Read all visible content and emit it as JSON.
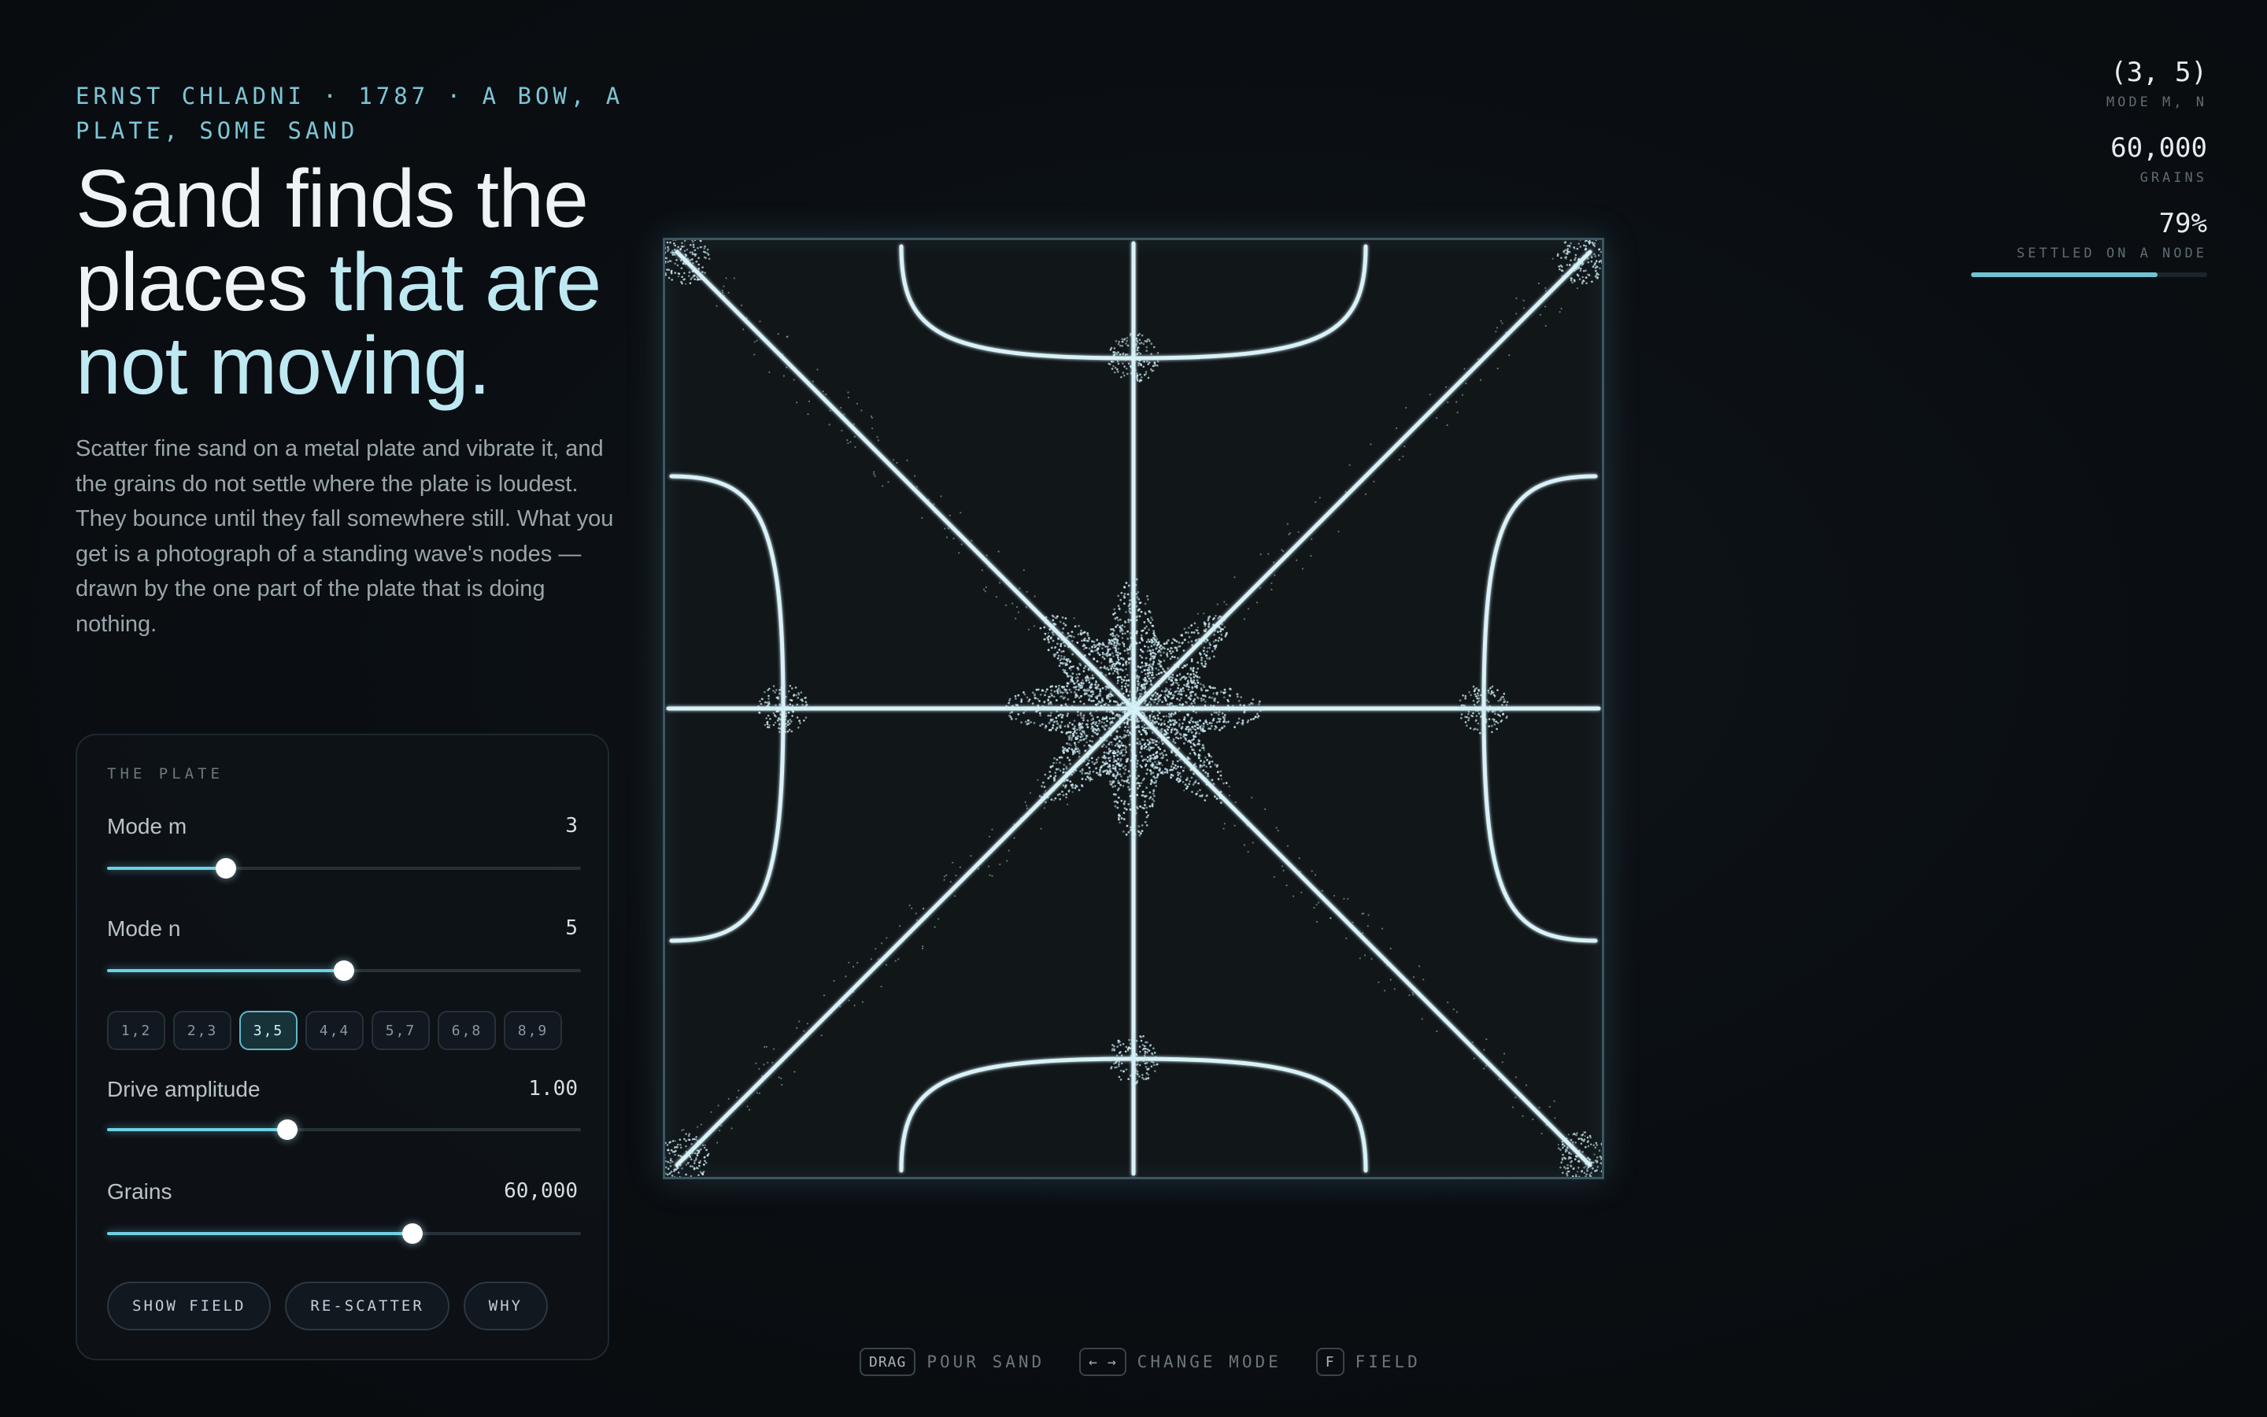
{
  "header": {
    "eyebrow": "ERNST CHLADNI · 1787 · A BOW, A PLATE, SOME SAND",
    "headline_lead": "Sand finds the places ",
    "headline_accent": "that are not moving.",
    "intro": "Scatter fine sand on a metal plate and vibrate it, and the grains do not settle where the plate is loudest. They bounce until they fall somewhere still. What you get is a photograph of a standing wave's nodes — drawn by the one part of the plate that is doing nothing."
  },
  "panel": {
    "title": "THE PLATE",
    "controls": [
      {
        "label": "Mode m",
        "value": "3",
        "fraction": 0.25
      },
      {
        "label": "Mode n",
        "value": "5",
        "fraction": 0.5
      },
      {
        "label": "Drive amplitude",
        "value": "1.00",
        "fraction": 0.38
      },
      {
        "label": "Grains",
        "value": "60,000",
        "fraction": 0.645
      }
    ],
    "presets": [
      "1,2",
      "2,3",
      "3,5",
      "4,4",
      "5,7",
      "6,8",
      "8,9"
    ],
    "active_preset": "3,5",
    "actions": [
      "SHOW FIELD",
      "RE-SCATTER",
      "WHY"
    ]
  },
  "stats": {
    "mode": {
      "value": "(3, 5)",
      "label": "MODE M, N"
    },
    "grains": {
      "value": "60,000",
      "label": "GRAINS"
    },
    "settled": {
      "value": "79%",
      "label": "SETTLED ON A NODE",
      "fraction": 0.79
    }
  },
  "hints": [
    {
      "key": "DRAG",
      "text": "POUR SAND"
    },
    {
      "key": "← →",
      "text": "CHANGE MODE"
    },
    {
      "key": "F",
      "text": "FIELD"
    }
  ],
  "colors": {
    "accent": "#6fd0e4",
    "sand": "#d8f2f8",
    "plate_bg": "#111619"
  }
}
